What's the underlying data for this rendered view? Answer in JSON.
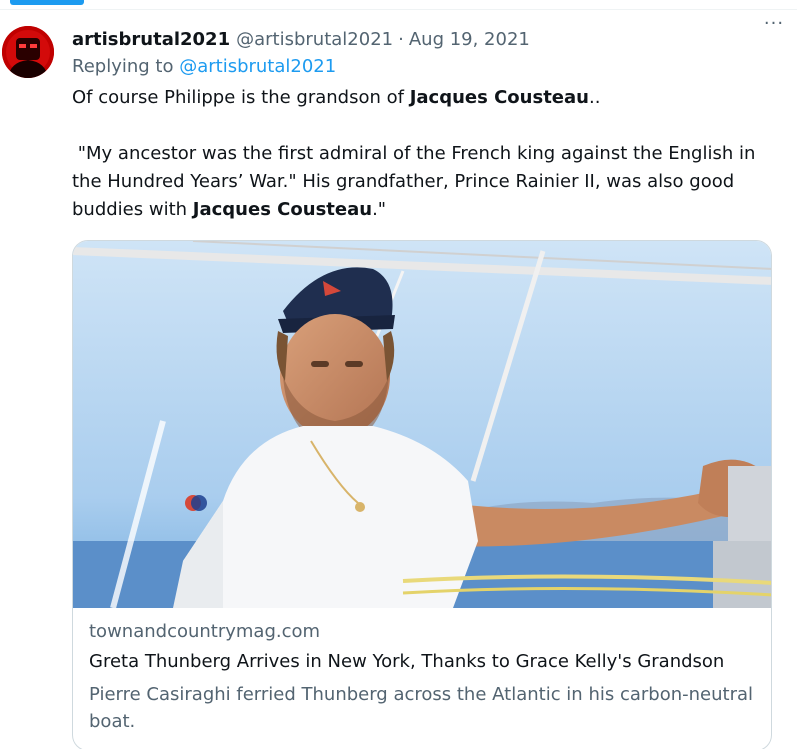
{
  "tweet": {
    "display_name": "artisbrutal2021",
    "handle": "@artisbrutal2021",
    "separator": "·",
    "date": "Aug 19, 2021",
    "more_icon": "more-horizontal-icon",
    "more_glyph": "···",
    "replying_prefix": "Replying to ",
    "replying_to": "@artisbrutal2021",
    "line1_prefix": "Of course Philippe is the grandson of ",
    "line1_bold": "Jacques Cousteau",
    "line1_suffix": "..",
    "para2_prefix": " \"My ancestor was the first admiral of the French king against the English in the Hundred Years’ War.\" His grandfather, Prince Rainier II, was also good buddies with ",
    "para2_bold": "Jacques Cousteau",
    "para2_suffix": ".\""
  },
  "card": {
    "domain": "townandcountrymag.com",
    "title": "Greta Thunberg Arrives in New York, Thanks to Grace Kelly's Grandson",
    "description": "Pierre Casiraghi ferried Thunberg across the Atlantic in his carbon-neutral boat."
  },
  "colors": {
    "accent": "#1d9bf0",
    "secondary_text": "#536471",
    "border": "#cfd9de"
  }
}
